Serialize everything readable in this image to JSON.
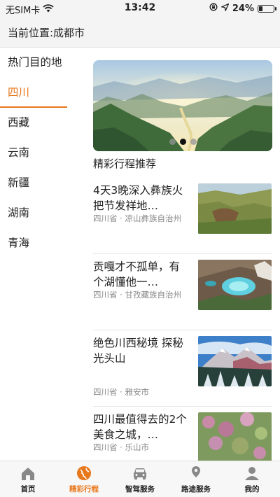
{
  "status_bar": {
    "carrier": "无SIM卡",
    "time": "13:42",
    "battery_text": "24%",
    "battery_level": 0.24,
    "icons": [
      "wifi-icon",
      "screen-lock-icon",
      "location-arrow-icon",
      "battery-icon"
    ]
  },
  "header": {
    "location": "当前位置:成都市"
  },
  "sidebar": {
    "items": [
      {
        "label": "热门目的地"
      },
      {
        "label": "四川"
      },
      {
        "label": "西藏"
      },
      {
        "label": "云南"
      },
      {
        "label": "新疆"
      },
      {
        "label": "湖南"
      },
      {
        "label": "青海"
      }
    ],
    "active_index": 1
  },
  "main": {
    "banner": {
      "slide_count": 3,
      "active_slide": 2
    },
    "section_title": "精彩行程推荐",
    "trips": [
      {
        "title": "4天3晚深入彝族火把节发祥地…",
        "location": "四川省 · 凉山彝族自治州"
      },
      {
        "title": "贡嘎才不孤单，有个湖懂他一…",
        "location": "四川省 · 甘孜藏族自治州"
      },
      {
        "title": "绝色川西秘境 探秘光头山",
        "location": "四川省 · 雅安市"
      },
      {
        "title": "四川最值得去的2个美食之城，…",
        "location": "四川省 · 乐山市"
      }
    ]
  },
  "tabbar": {
    "tabs": [
      {
        "label": "首页",
        "icon": "home-icon"
      },
      {
        "label": "精彩行程",
        "icon": "globe-icon"
      },
      {
        "label": "智驾服务",
        "icon": "car-icon"
      },
      {
        "label": "路途服务",
        "icon": "route-icon"
      },
      {
        "label": "我的",
        "icon": "user-icon"
      }
    ],
    "active_index": 1
  },
  "colors": {
    "accent": "#e8781c",
    "header_bg": "#f4f4f4",
    "muted_text": "#888888"
  }
}
